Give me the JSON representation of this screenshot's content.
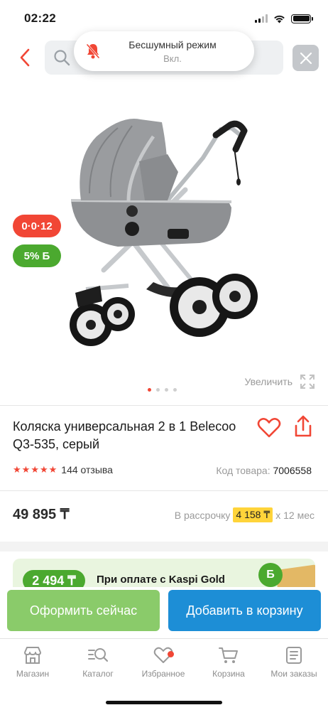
{
  "status_bar": {
    "time": "02:22"
  },
  "toast": {
    "title": "Бесшумный режим",
    "subtitle": "Вкл."
  },
  "gallery": {
    "badge_installment": "0·0·12",
    "badge_bonus": "5% Б",
    "zoom_label": "Увеличить",
    "image_count": 4,
    "active_image": 1
  },
  "product": {
    "title": "Коляска универсальная 2 в 1 Belecoo Q3-535, серый",
    "rating": 5,
    "reviews": "144 отзыва",
    "code_label": "Код товара:",
    "code_value": "7006558",
    "price": "49 895 ₸",
    "installment_prefix": "В рассрочку",
    "installment_amount": "4 158 ₸",
    "installment_suffix": "x 12 мес"
  },
  "promo": {
    "bonus": "2 494 ₸",
    "text": "При оплате с Kaspi Gold",
    "coin": "Б"
  },
  "actions": {
    "buy_label": "Оформить сейчас",
    "cart_label": "Добавить в корзину"
  },
  "tabs": [
    {
      "label": "Магазин",
      "icon": "shop-icon"
    },
    {
      "label": "Каталог",
      "icon": "catalog-search-icon"
    },
    {
      "label": "Избранное",
      "icon": "heart-icon"
    },
    {
      "label": "Корзина",
      "icon": "cart-icon"
    },
    {
      "label": "Мои заказы",
      "icon": "orders-icon"
    }
  ],
  "colors": {
    "accent_red": "#f14635",
    "bonus_green": "#4ba92f",
    "buy_button": "#8acb6a",
    "cart_button": "#1d8ed6",
    "installment_highlight": "#ffd43a"
  }
}
